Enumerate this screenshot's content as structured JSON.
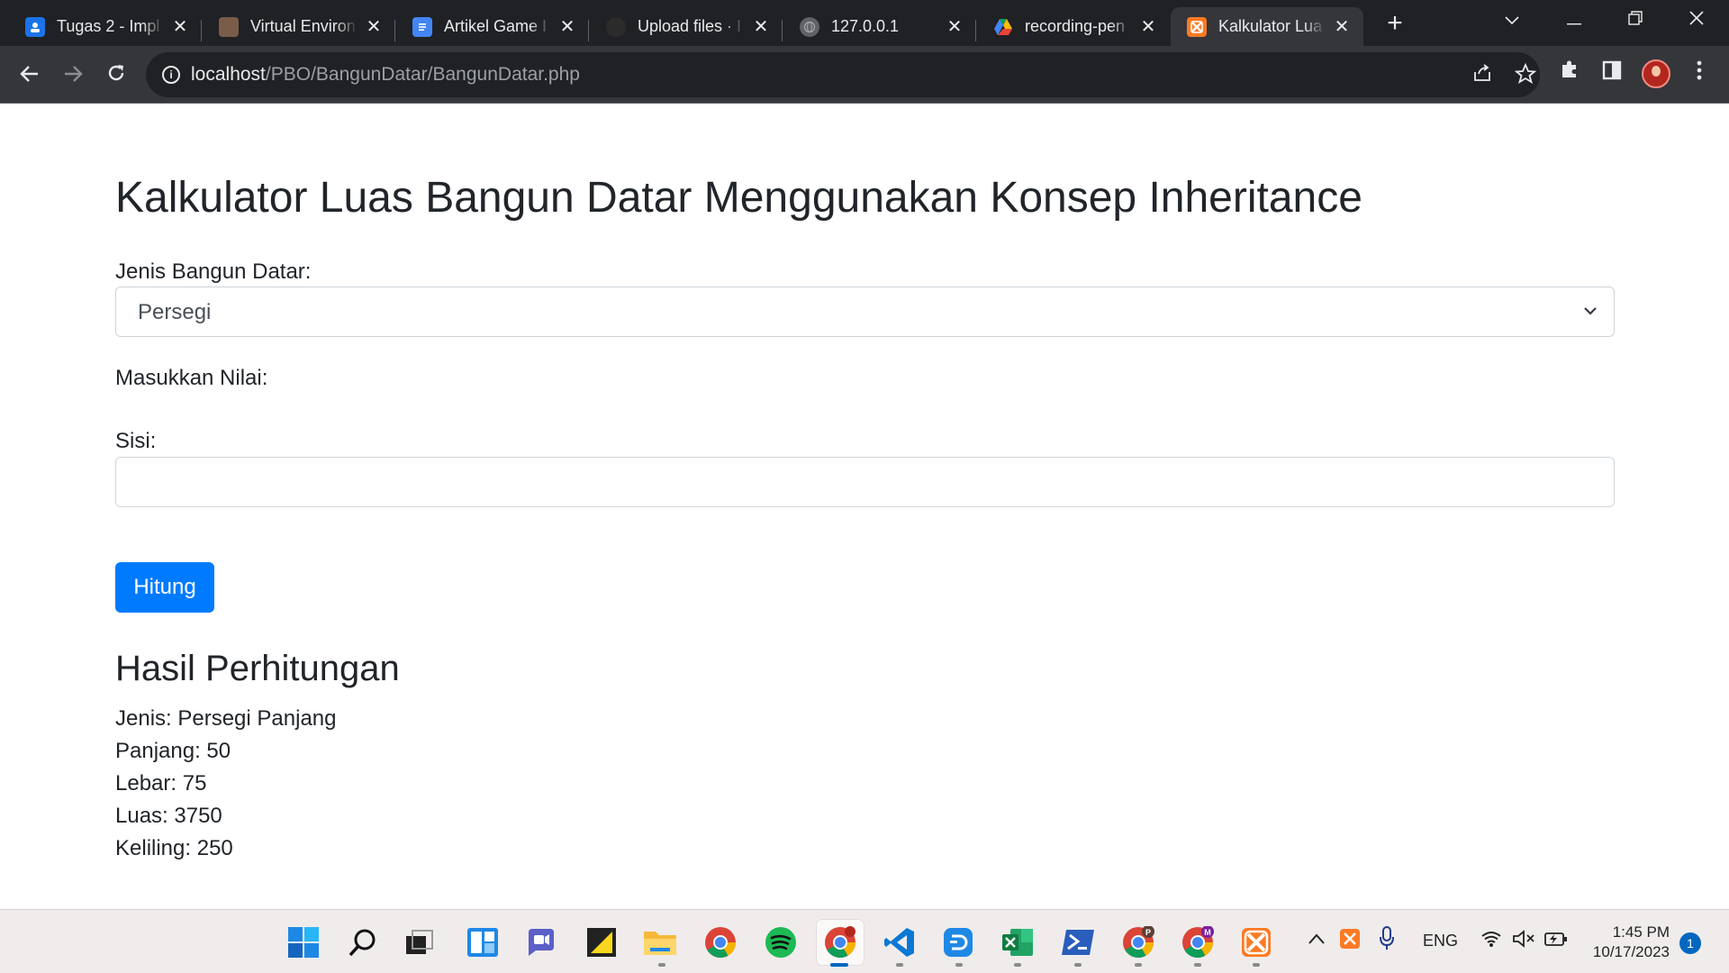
{
  "browser": {
    "tabs": [
      {
        "title": "Tugas 2 - Impl",
        "favicon": "classroom-icon",
        "color": "#1a73e8"
      },
      {
        "title": "Virtual Environ",
        "favicon": "avatar-icon",
        "color": "#7a5c4a"
      },
      {
        "title": "Artikel Game I",
        "favicon": "docs-icon",
        "color": "#4285f4"
      },
      {
        "title": "Upload files · I",
        "favicon": "github-icon",
        "color": "#2b2b2b"
      },
      {
        "title": "127.0.0.1",
        "favicon": "globe-icon",
        "color": "#5f6368"
      },
      {
        "title": "recording-pen",
        "favicon": "drive-icon",
        "color": "#fbbc04"
      },
      {
        "title": "Kalkulator Lua",
        "favicon": "xampp-icon",
        "color": "#fb7a24",
        "active": true
      }
    ],
    "url_host": "localhost",
    "url_path": "/PBO/BangunDatar/BangunDatar.php"
  },
  "page": {
    "title": "Kalkulator Luas Bangun Datar Menggunakan Konsep Inheritance",
    "jenis_label": "Jenis Bangun Datar:",
    "jenis_selected": "Persegi",
    "nilai_label": "Masukkan Nilai:",
    "sisi_label": "Sisi:",
    "sisi_value": "",
    "hitung_label": "Hitung",
    "hasil_heading": "Hasil Perhitungan",
    "hasil": {
      "jenis": "Jenis: Persegi Panjang",
      "panjang": "Panjang: 50",
      "lebar": "Lebar: 75",
      "luas": "Luas: 3750",
      "keliling": "Keliling: 250"
    },
    "accent": "#007bff"
  },
  "taskbar": {
    "apps": [
      "windows-start-icon",
      "search-icon",
      "task-view-icon",
      "widgets-icon",
      "chat-icon",
      "sticky-notes-icon",
      "file-explorer-icon",
      "chrome-icon",
      "spotify-icon",
      "chrome-profile-icon",
      "vscode-icon",
      "app-icon",
      "excel-icon",
      "powershell-icon",
      "chrome-p-icon",
      "chrome-m-icon",
      "xampp-icon"
    ],
    "profile_p": "P",
    "profile_m": "M",
    "language": "ENG",
    "time": "1:45 PM",
    "date": "10/17/2023",
    "notifications": "1"
  }
}
